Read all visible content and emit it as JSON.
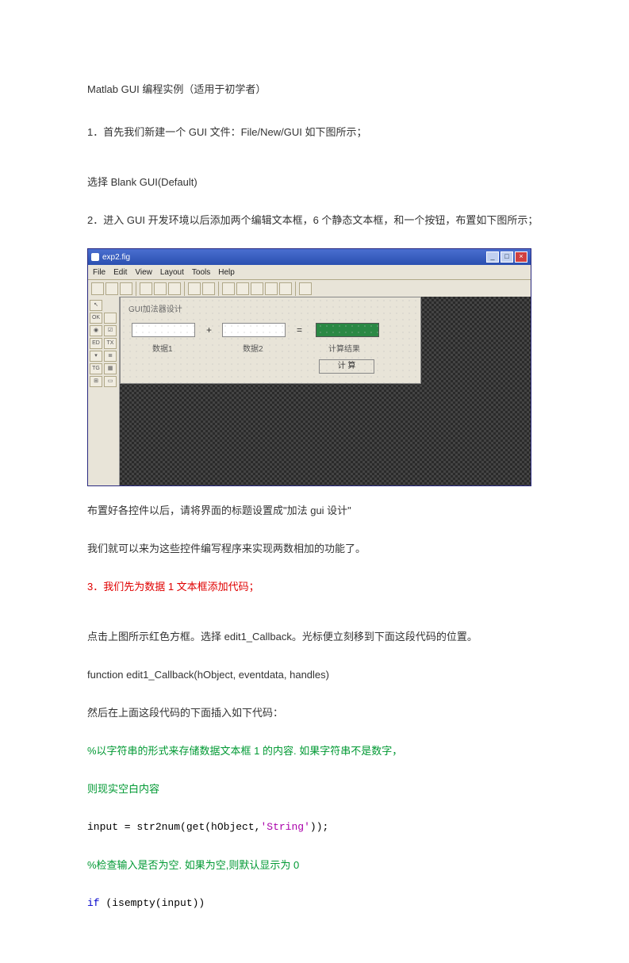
{
  "title": "Matlab GUI 编程实例（适用于初学者）",
  "para1": "1．首先我们新建一个 GUI 文件：File/New/GUI  如下图所示；",
  "para2": "选择 Blank GUI(Default)",
  "para3": "2．进入 GUI 开发环境以后添加两个编辑文本框，6 个静态文本框，和一个按钮，布置如下图所示；",
  "para4": "布置好各控件以后，请将界面的标题设置成\"加法 gui 设计\"",
  "para5": "我们就可以来为这些控件编写程序来实现两数相加的功能了。",
  "para6": "3．我们先为数据 1 文本框添加代码；",
  "para7": "点击上图所示红色方框。选择 edit1_Callback。光标便立刻移到下面这段代码的位置。",
  "func_kw": "function",
  "func_sig": " edit1_Callback(hObject, eventdata, handles)",
  "para8": "然后在上面这段代码的下面插入如下代码：",
  "comment1": "%以字符串的形式来存储数据文本框 1 的内容. 如果字符串不是数字，",
  "comment2": "则现实空白内容",
  "code1": {
    "a": "input = ",
    "b": "str2num",
    "c": "(",
    "d": "get",
    "e": "(hObject,",
    "f": "'String'",
    "g": "));"
  },
  "comment3": "%检查输入是否为空. 如果为空,则默认显示为 0",
  "code2": {
    "a": "if",
    "b": " (isempty(input))"
  },
  "fig": {
    "window_title": "exp2.fig",
    "menus": [
      "File",
      "Edit",
      "View",
      "Layout",
      "Tools",
      "Help"
    ],
    "gui_title": "GUI加法器设计",
    "label_data1": "数据1",
    "label_data2": "数据2",
    "label_result": "计算结果",
    "plus": "+",
    "equals": "=",
    "calc_button": "计 算"
  }
}
